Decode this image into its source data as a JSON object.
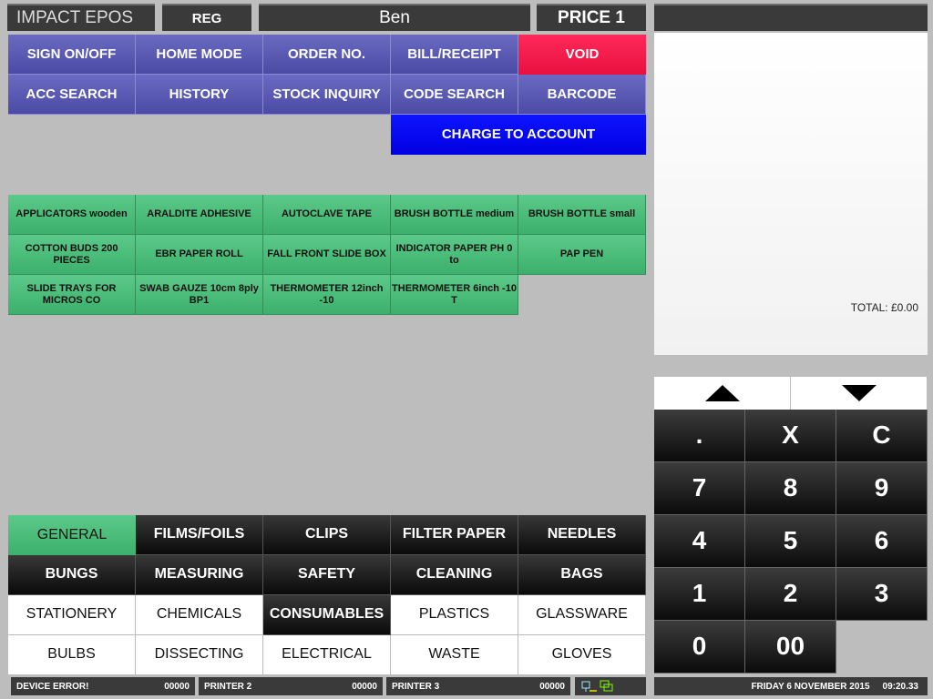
{
  "header": {
    "app_title": "IMPACT EPOS",
    "mode": "REG",
    "user": "Ben",
    "price_level": "PRICE 1"
  },
  "function_buttons": {
    "row1": [
      "SIGN ON/OFF",
      "HOME MODE",
      "ORDER NO.",
      "BILL/RECEIPT",
      "VOID"
    ],
    "row2": [
      "ACC SEARCH",
      "HISTORY",
      "STOCK INQUIRY",
      "CODE SEARCH",
      "BARCODE"
    ],
    "charge_to_account": "CHARGE TO ACCOUNT"
  },
  "products": [
    "APPLICATORS wooden",
    "ARALDITE ADHESIVE",
    "AUTOCLAVE TAPE",
    "BRUSH BOTTLE medium",
    "BRUSH BOTTLE small",
    "COTTON BUDS 200 PIECES",
    "EBR PAPER ROLL",
    "FALL FRONT SLIDE BOX",
    "INDICATOR PAPER PH 0 to",
    "PAP PEN",
    "SLIDE TRAYS FOR MICROS CO",
    "SWAB GAUZE 10cm 8ply BP1",
    "THERMOMETER 12inch -10",
    "THERMOMETER 6inch -10 T"
  ],
  "categories": [
    "GENERAL",
    "FILMS/FOILS",
    "CLIPS",
    "FILTER PAPER",
    "NEEDLES",
    "BUNGS",
    "MEASURING",
    "SAFETY",
    "CLEANING",
    "BAGS",
    "STATIONERY",
    "CHEMICALS",
    "CONSUMABLES",
    "PLASTICS",
    "GLASSWARE",
    "BULBS",
    "DISSECTING",
    "ELECTRICAL",
    "WASTE",
    "GLOVES"
  ],
  "receipt": {
    "total": "TOTAL: £0.00"
  },
  "keypad": [
    ".",
    "X",
    "C",
    "7",
    "8",
    "9",
    "4",
    "5",
    "6",
    "1",
    "2",
    "3",
    "0",
    "00"
  ],
  "status_bar": {
    "device_error": "DEVICE ERROR!",
    "device_error_code": "00000",
    "printer2": "PRINTER 2",
    "printer2_code": "00000",
    "printer3": "PRINTER 3",
    "printer3_code": "00000",
    "datetime_date": "FRIDAY 6 NOVEMBER 2015",
    "datetime_time": "09:20.33"
  },
  "colors": {
    "accent_blue": "#5757b0",
    "void_red": "#f01a48",
    "product_green": "#4cbd7b"
  }
}
